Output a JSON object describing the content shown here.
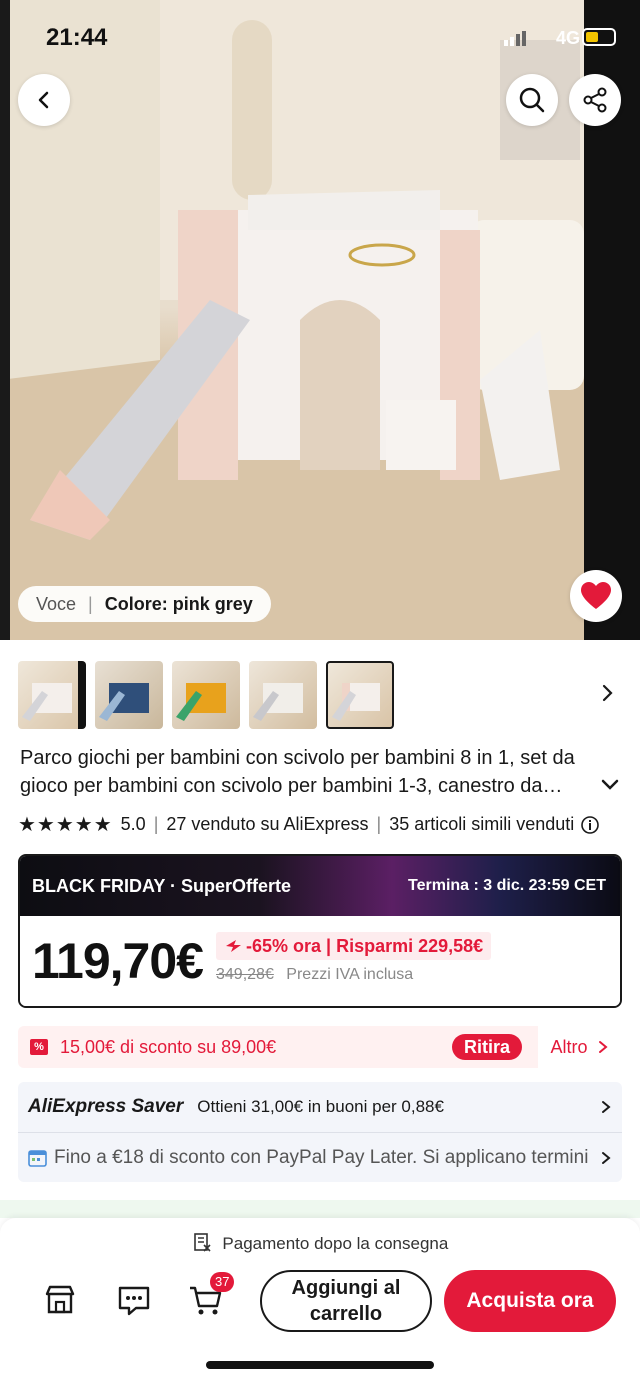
{
  "status": {
    "time": "21:44",
    "network": "4G"
  },
  "hero": {
    "variant_prefix": "Voce",
    "variant_value": "Colore: pink grey"
  },
  "product": {
    "title": "Parco giochi per bambini con scivolo per bambini 8 in 1, set da gioco per bambini con scivolo per bambini 1-3, canestro da basket",
    "stars_glyph": "★★★★★",
    "rating": "5.0",
    "sold": "27 venduto su AliExpress",
    "similar": "35 articoli simili venduti"
  },
  "black_friday": {
    "label": "BLACK FRIDAY · SuperOfferte",
    "ends": "Termina : 3 dic. 23:59 CET",
    "price": "119,70€",
    "discount": "-65% ora |  Risparmi 229,58€",
    "original_price": "349,28€",
    "vat_note": "Prezzi IVA inclusa"
  },
  "coupon": {
    "icon_text": "%",
    "text": "15,00€ di sconto su 89,00€",
    "claim": "Ritira",
    "more": "Altro"
  },
  "saver": {
    "logo": "AliExpress Saver",
    "text": "Ottieni 31,00€ in buoni per 0,88€",
    "paypal": "Fino a €18 di sconto con PayPal Pay Later. Si applicano termini"
  },
  "bottom": {
    "payment_note": "Pagamento dopo la consegna",
    "cart_count": "37",
    "add_to_cart": "Aggiungi al carrello",
    "buy_now": "Acquista ora"
  },
  "colors": {
    "accent": "#e31a3a",
    "dark": "#191919"
  }
}
